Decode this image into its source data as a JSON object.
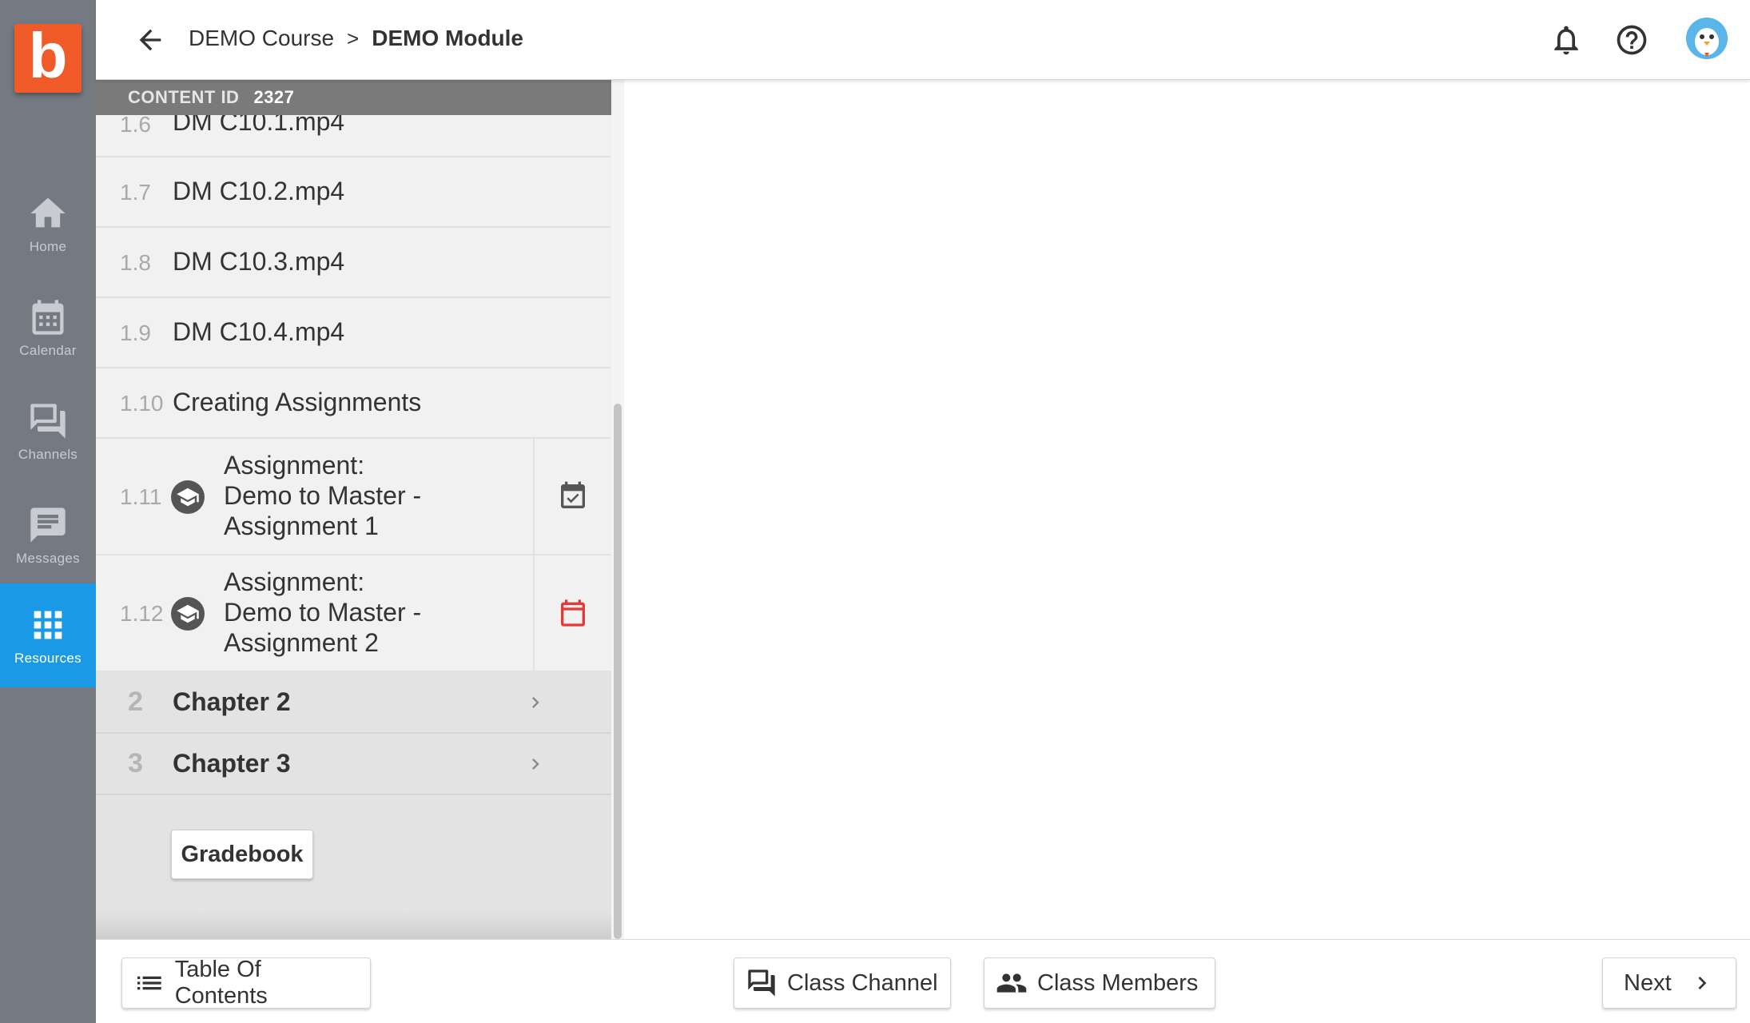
{
  "app": {
    "logo_letter": "b",
    "brand_color": "#f05a28",
    "accent_color": "#1a9ae6"
  },
  "nav": {
    "items": [
      {
        "label": "Home",
        "icon": "home-icon",
        "active": false
      },
      {
        "label": "Calendar",
        "icon": "calendar-icon",
        "active": false
      },
      {
        "label": "Channels",
        "icon": "channels-icon",
        "active": false
      },
      {
        "label": "Messages",
        "icon": "messages-icon",
        "active": false
      },
      {
        "label": "Resources",
        "icon": "apps-grid-icon",
        "active": true
      }
    ]
  },
  "header": {
    "breadcrumb": [
      "DEMO Course",
      "DEMO Module"
    ],
    "separator": ">",
    "icons": [
      "back-arrow-icon",
      "bell-icon",
      "help-icon",
      "avatar"
    ]
  },
  "toc": {
    "content_id_label": "CONTENT ID",
    "content_id_value": "2327",
    "items": [
      {
        "num": "1.6",
        "title": "DM C10.1.mp4"
      },
      {
        "num": "1.7",
        "title": "DM C10.2.mp4"
      },
      {
        "num": "1.8",
        "title": "DM C10.3.mp4"
      },
      {
        "num": "1.9",
        "title": "DM C10.4.mp4"
      },
      {
        "num": "1.10",
        "title": "Creating Assignments"
      }
    ],
    "assignments": [
      {
        "num": "1.11",
        "line1": "Assignment:",
        "line2": "Demo to Master -",
        "line3": "Assignment 1",
        "status_icon": "calendar-check-icon",
        "status_color": "#555555"
      },
      {
        "num": "1.12",
        "line1": "Assignment:",
        "line2": "Demo to Master -",
        "line3": "Assignment 2",
        "status_icon": "calendar-icon",
        "status_color": "#e53935"
      }
    ],
    "chapters": [
      {
        "num": "2",
        "title": "Chapter 2"
      },
      {
        "num": "3",
        "title": "Chapter 3"
      }
    ],
    "gradebook_label": "Gradebook"
  },
  "footer": {
    "toc_label": "Table Of Contents",
    "channel_label": "Class Channel",
    "members_label": "Class Members",
    "next_label": "Next"
  }
}
